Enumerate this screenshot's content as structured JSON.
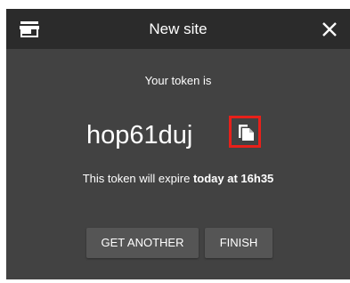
{
  "dialog": {
    "title": "New site",
    "title_icon": "store-icon",
    "close_icon": "close-icon"
  },
  "content": {
    "subtitle": "Your token is",
    "token": "hop61duj",
    "copy_icon": "copy-icon",
    "expire_prefix": "This token will expire ",
    "expire_time": "today at 16h35"
  },
  "actions": {
    "get_another_label": "GET ANOTHER",
    "finish_label": "FINISH"
  },
  "colors": {
    "dialog_bg": "#424242",
    "titlebar_bg": "#2b2b2b",
    "button_bg": "#555555",
    "highlight": "#e8201a",
    "text": "#ffffff"
  }
}
